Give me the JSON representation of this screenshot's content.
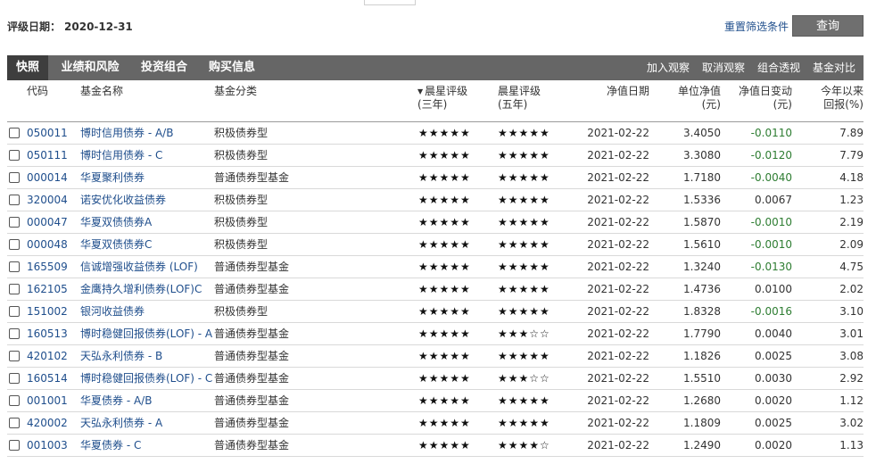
{
  "rating_date": {
    "label": "评级日期：",
    "value": "2020-12-31"
  },
  "reset_link": "重置筛选条件",
  "query_button": "查询",
  "tabs": [
    {
      "label": "快照"
    },
    {
      "label": "业绩和风险"
    },
    {
      "label": "投资组合"
    },
    {
      "label": "购买信息"
    }
  ],
  "actions": [
    {
      "label": "加入观察"
    },
    {
      "label": "取消观察"
    },
    {
      "label": "组合透视"
    },
    {
      "label": "基金对比"
    }
  ],
  "columns": {
    "code": "代码",
    "name": "基金名称",
    "category": "基金分类",
    "rating3_l1": "晨星评级",
    "rating3_l2": "(三年)",
    "rating5_l1": "晨星评级",
    "rating5_l2": "(五年)",
    "nav_date": "净值日期",
    "nav_l1": "单位净值",
    "nav_l2": "(元)",
    "change_l1": "净值日变动",
    "change_l2": "(元)",
    "ytd_l1": "今年以来",
    "ytd_l2": "回报(%)"
  },
  "colors": {
    "link": "#1f4e8c",
    "negative": "#2e7d32",
    "tabbar": "#666666",
    "active_tab": "#3e3e3e"
  },
  "rows": [
    {
      "code": "050011",
      "name": "博时信用债券 - A/B",
      "category": "积极债券型",
      "r3": 5,
      "r5": 5,
      "date": "2021-02-22",
      "nav": "3.4050",
      "change": "-0.0110",
      "ytd": "7.89"
    },
    {
      "code": "050111",
      "name": "博时信用债券 - C",
      "category": "积极债券型",
      "r3": 5,
      "r5": 5,
      "date": "2021-02-22",
      "nav": "3.3080",
      "change": "-0.0120",
      "ytd": "7.79"
    },
    {
      "code": "000014",
      "name": "华夏聚利债券",
      "category": "普通债券型基金",
      "r3": 5,
      "r5": 5,
      "date": "2021-02-22",
      "nav": "1.7180",
      "change": "-0.0040",
      "ytd": "4.18"
    },
    {
      "code": "320004",
      "name": "诺安优化收益债券",
      "category": "积极债券型",
      "r3": 5,
      "r5": 5,
      "date": "2021-02-22",
      "nav": "1.5336",
      "change": "0.0067",
      "ytd": "1.23"
    },
    {
      "code": "000047",
      "name": "华夏双债债券A",
      "category": "积极债券型",
      "r3": 5,
      "r5": 5,
      "date": "2021-02-22",
      "nav": "1.5870",
      "change": "-0.0010",
      "ytd": "2.19"
    },
    {
      "code": "000048",
      "name": "华夏双债债券C",
      "category": "积极债券型",
      "r3": 5,
      "r5": 5,
      "date": "2021-02-22",
      "nav": "1.5610",
      "change": "-0.0010",
      "ytd": "2.09"
    },
    {
      "code": "165509",
      "name": "信诚增强收益债券 (LOF)",
      "category": "普通债券型基金",
      "r3": 5,
      "r5": 5,
      "date": "2021-02-22",
      "nav": "1.3240",
      "change": "-0.0130",
      "ytd": "4.75"
    },
    {
      "code": "162105",
      "name": "金鹰持久增利债券(LOF)C",
      "category": "普通债券型基金",
      "r3": 5,
      "r5": 5,
      "date": "2021-02-22",
      "nav": "1.4736",
      "change": "0.0100",
      "ytd": "2.02"
    },
    {
      "code": "151002",
      "name": "银河收益债券",
      "category": "积极债券型",
      "r3": 5,
      "r5": 5,
      "date": "2021-02-22",
      "nav": "1.8328",
      "change": "-0.0016",
      "ytd": "3.10"
    },
    {
      "code": "160513",
      "name": "博时稳健回报债券(LOF) - A",
      "category": "普通债券型基金",
      "r3": 5,
      "r5": 3,
      "date": "2021-02-22",
      "nav": "1.7790",
      "change": "0.0040",
      "ytd": "3.01"
    },
    {
      "code": "420102",
      "name": "天弘永利债券 - B",
      "category": "普通债券型基金",
      "r3": 5,
      "r5": 5,
      "date": "2021-02-22",
      "nav": "1.1826",
      "change": "0.0025",
      "ytd": "3.08"
    },
    {
      "code": "160514",
      "name": "博时稳健回报债券(LOF) - C",
      "category": "普通债券型基金",
      "r3": 5,
      "r5": 3,
      "date": "2021-02-22",
      "nav": "1.5510",
      "change": "0.0030",
      "ytd": "2.92"
    },
    {
      "code": "001001",
      "name": "华夏债券 - A/B",
      "category": "普通债券型基金",
      "r3": 5,
      "r5": 5,
      "date": "2021-02-22",
      "nav": "1.2680",
      "change": "0.0020",
      "ytd": "1.12"
    },
    {
      "code": "420002",
      "name": "天弘永利债券 - A",
      "category": "普通债券型基金",
      "r3": 5,
      "r5": 5,
      "date": "2021-02-22",
      "nav": "1.1809",
      "change": "0.0025",
      "ytd": "3.02"
    },
    {
      "code": "001003",
      "name": "华夏债券 - C",
      "category": "普通债券型基金",
      "r3": 5,
      "r5": 4,
      "date": "2021-02-22",
      "nav": "1.2490",
      "change": "0.0020",
      "ytd": "1.13"
    }
  ]
}
